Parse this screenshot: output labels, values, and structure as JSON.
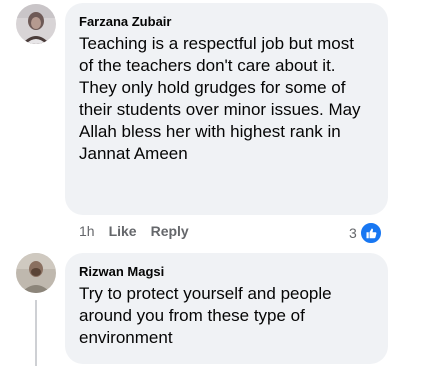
{
  "comments": [
    {
      "author": "Farzana Zubair",
      "text": "Teaching is a respectful job but most of the teachers don't care about it. They only hold grudges for some of their students over minor issues. May Allah bless her with highest rank in Jannat Ameen",
      "time": "1h",
      "like_label": "Like",
      "reply_label": "Reply",
      "reaction_count": "3",
      "reaction_icon": "thumbs-up-icon"
    },
    {
      "author": "Rizwan Magsi",
      "text": "Try to protect yourself and people around you from these type of environment"
    }
  ],
  "colors": {
    "bubble": "#f0f2f5",
    "meta_text": "#65676b",
    "like_blue": "#1877f2"
  }
}
